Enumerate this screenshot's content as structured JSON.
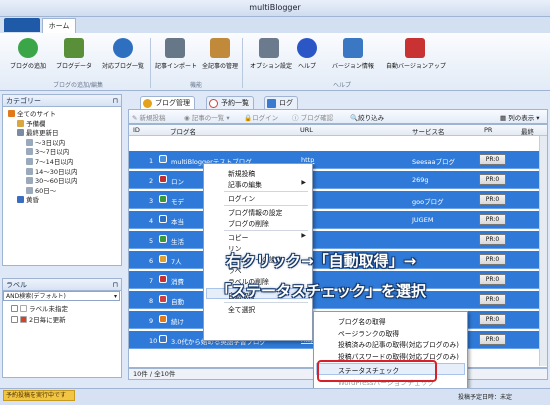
{
  "window": {
    "title": "multiBlogger"
  },
  "ribbon_tabs": {
    "file": "",
    "home": "ホーム"
  },
  "ribbon": {
    "buttons": [
      {
        "label": "ブログの追加",
        "icon": "add-circle-icon",
        "color": "#3aa648"
      },
      {
        "label": "ブログデータ",
        "icon": "table-icon",
        "color": "#5a8f3a"
      },
      {
        "label": "対応ブログ一覧",
        "icon": "globe-icon",
        "color": "#2f6fbf"
      },
      {
        "label": "記事インポート",
        "icon": "import-icon",
        "color": "#667788"
      },
      {
        "label": "全記事の管理",
        "icon": "document-list-icon",
        "color": "#c08a3a"
      },
      {
        "label": "オプション設定",
        "icon": "gear-icon",
        "color": "#6b7a8c"
      },
      {
        "label": "ヘルプ",
        "icon": "help-icon",
        "color": "#2a56c6"
      },
      {
        "label": "バージョン情報",
        "icon": "monitor-check-icon",
        "color": "#3a78c4"
      },
      {
        "label": "自動バージョンアップ",
        "icon": "monitor-update-icon",
        "color": "#c83232"
      }
    ],
    "groups": [
      "ブログの追加/編集",
      "機能",
      "ヘルプ"
    ]
  },
  "category_pane": {
    "title": "カテゴリー",
    "items": [
      {
        "label": "全てのサイト",
        "level": 0,
        "icon_color": "#e07a1a"
      },
      {
        "label": "予備欄",
        "level": 1,
        "icon_color": "#d9a640"
      },
      {
        "label": "最終更新日",
        "level": 1,
        "icon_color": "#7a8ca3"
      },
      {
        "label": "～3日以内",
        "level": 2,
        "icon_color": "#9aa9bb"
      },
      {
        "label": "3～7日以内",
        "level": 2,
        "icon_color": "#9aa9bb"
      },
      {
        "label": "7～14日以内",
        "level": 2,
        "icon_color": "#9aa9bb"
      },
      {
        "label": "14～30日以内",
        "level": 2,
        "icon_color": "#9aa9bb"
      },
      {
        "label": "30～60日以内",
        "level": 2,
        "icon_color": "#9aa9bb"
      },
      {
        "label": "60日～",
        "level": 2,
        "icon_color": "#9aa9bb"
      },
      {
        "label": "黄昏",
        "level": 1,
        "icon_color": "#3a6cc0"
      }
    ]
  },
  "label_pane": {
    "title": "ラベル",
    "filter": "AND検索(デフォルト)",
    "items": [
      {
        "label": "ラベル未指定",
        "icon_color": "#ffffff"
      },
      {
        "label": "2日毎に更新",
        "icon_color": "#d9402a"
      }
    ]
  },
  "main_tabs": [
    {
      "label": "ブログ管理",
      "icon_color": "#e3a21a"
    },
    {
      "label": "予約一覧",
      "icon_color": "#d04040"
    },
    {
      "label": "ログ",
      "icon_color": "#3a7ad0"
    }
  ],
  "toolbar": {
    "new_post": "新規投稿",
    "post_list": "記事の一覧",
    "login": "ログイン",
    "check": "ブログ確認",
    "search": "絞り込み",
    "columns": "列の表示"
  },
  "grid": {
    "columns": {
      "id": "ID",
      "name": "ブログ名",
      "url": "URL",
      "service": "サービス名",
      "pr": "PR",
      "last": "最終"
    },
    "rows": [
      {
        "id": "1",
        "name": "multiBloggerテストブログ",
        "url": "http",
        "service": "Seesaaブログ",
        "pr": "PR:0",
        "icon": "#4a90d9"
      },
      {
        "id": "2",
        "name": "ロン",
        "url": "",
        "service": "269g",
        "pr": "PR:0",
        "icon": "#c03030"
      },
      {
        "id": "3",
        "name": "モデ",
        "url": "",
        "service": "gooブログ",
        "pr": "PR:0",
        "icon": "#3a9a3a"
      },
      {
        "id": "4",
        "name": "本当",
        "url": "",
        "service": "JUGEM",
        "pr": "PR:0",
        "icon": "#2f6fbf"
      },
      {
        "id": "5",
        "name": "生活",
        "url": "",
        "service": "",
        "pr": "PR:0",
        "icon": "#3a9a3a"
      },
      {
        "id": "6",
        "name": "7人",
        "url": "",
        "service": "",
        "pr": "PR:0",
        "icon": "#e0a030"
      },
      {
        "id": "7",
        "name": "消費",
        "url": "",
        "service": "",
        "pr": "PR:0",
        "icon": "#c83232"
      },
      {
        "id": "8",
        "name": "自動",
        "url": "",
        "service": "",
        "pr": "PR:0",
        "icon": "#d04040"
      },
      {
        "id": "9",
        "name": "続け",
        "url": "",
        "service": "",
        "pr": "PR:0",
        "icon": "#e07a1a"
      },
      {
        "id": "10",
        "name": "3.0代から始める英語学習ブログ",
        "url": "http",
        "service": "",
        "pr": "PR:0",
        "icon": "#3a78c4"
      }
    ],
    "footer": "10件 / 全10件"
  },
  "context_menu": {
    "items": [
      {
        "label": "新規投稿",
        "disabled": false,
        "submenu": false
      },
      {
        "label": "記事の編集",
        "disabled": false,
        "submenu": true
      },
      {
        "sep": true
      },
      {
        "label": "ログイン",
        "disabled": false,
        "submenu": false
      },
      {
        "sep": true
      },
      {
        "label": "ブログ情報の設定",
        "disabled": false,
        "submenu": false
      },
      {
        "label": "ブログの削除",
        "disabled": false,
        "submenu": false
      },
      {
        "sep": true
      },
      {
        "label": "コピー",
        "disabled": false,
        "submenu": true
      },
      {
        "label": "リン",
        "disabled": false,
        "submenu": false
      },
      {
        "label": "カテゴリーの設定",
        "disabled": false,
        "submenu": false
      },
      {
        "label": "ラベ",
        "disabled": false,
        "submenu": false
      },
      {
        "label": "ラベルの削除",
        "disabled": false,
        "submenu": false
      },
      {
        "sep": true
      },
      {
        "label": "自動取得",
        "disabled": false,
        "submenu": true,
        "highlight": true
      },
      {
        "sep": true
      },
      {
        "label": "全て選択",
        "disabled": false,
        "submenu": false
      }
    ]
  },
  "sub_menu": {
    "items": [
      {
        "label": "ブログ名の取得",
        "disabled": false
      },
      {
        "label": "ページランクの取得",
        "disabled": false
      },
      {
        "label": "投稿済みの記事の取得(対応ブログのみ)",
        "disabled": false
      },
      {
        "label": "投稿パスワードの取得(対応ブログのみ)",
        "disabled": false
      },
      {
        "sep": true
      },
      {
        "label": "ステータスチェック",
        "disabled": false,
        "highlight": true
      },
      {
        "label": "WordPressバージョンチェック",
        "disabled": true
      }
    ]
  },
  "annotation": {
    "line1": "右クリック→「自動取得」→",
    "line2": "「ステータスチェック」を選択"
  },
  "status": {
    "warning": "予約投稿を実行中です",
    "right": "投稿予定日時：未定"
  },
  "colors": {
    "accent": "#2f7ad8",
    "highlight_red": "#d8202a",
    "ribbon_file_tab": "#1e5aa8"
  }
}
